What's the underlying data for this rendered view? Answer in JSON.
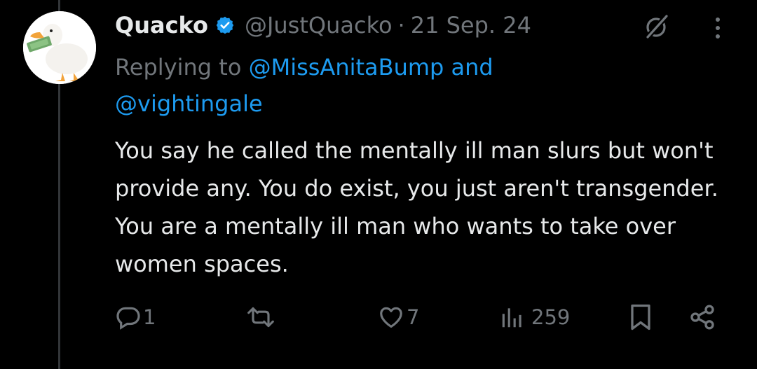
{
  "tweet": {
    "display_name": "Quacko",
    "handle": "@JustQuacko",
    "separator": "·",
    "date": "21 Sep. 24",
    "replying_to_prefix": "Replying to",
    "replying_to_user1": "@MissAnitaBump",
    "replying_to_and": "and",
    "replying_to_user2": "@vightingale",
    "text": "You say he called the mentally ill man slurs but won't provide any. You do exist, you just aren't transgender. You are a mentally ill man who wants to take over women spaces."
  },
  "actions": {
    "reply_count": "1",
    "retweet_count": "",
    "like_count": "7",
    "views_count": "259"
  },
  "colors": {
    "background": "#000000",
    "text": "#e7e9ea",
    "secondary": "#71767b",
    "link": "#1d9bf0",
    "verified": "#1d9bf0"
  }
}
